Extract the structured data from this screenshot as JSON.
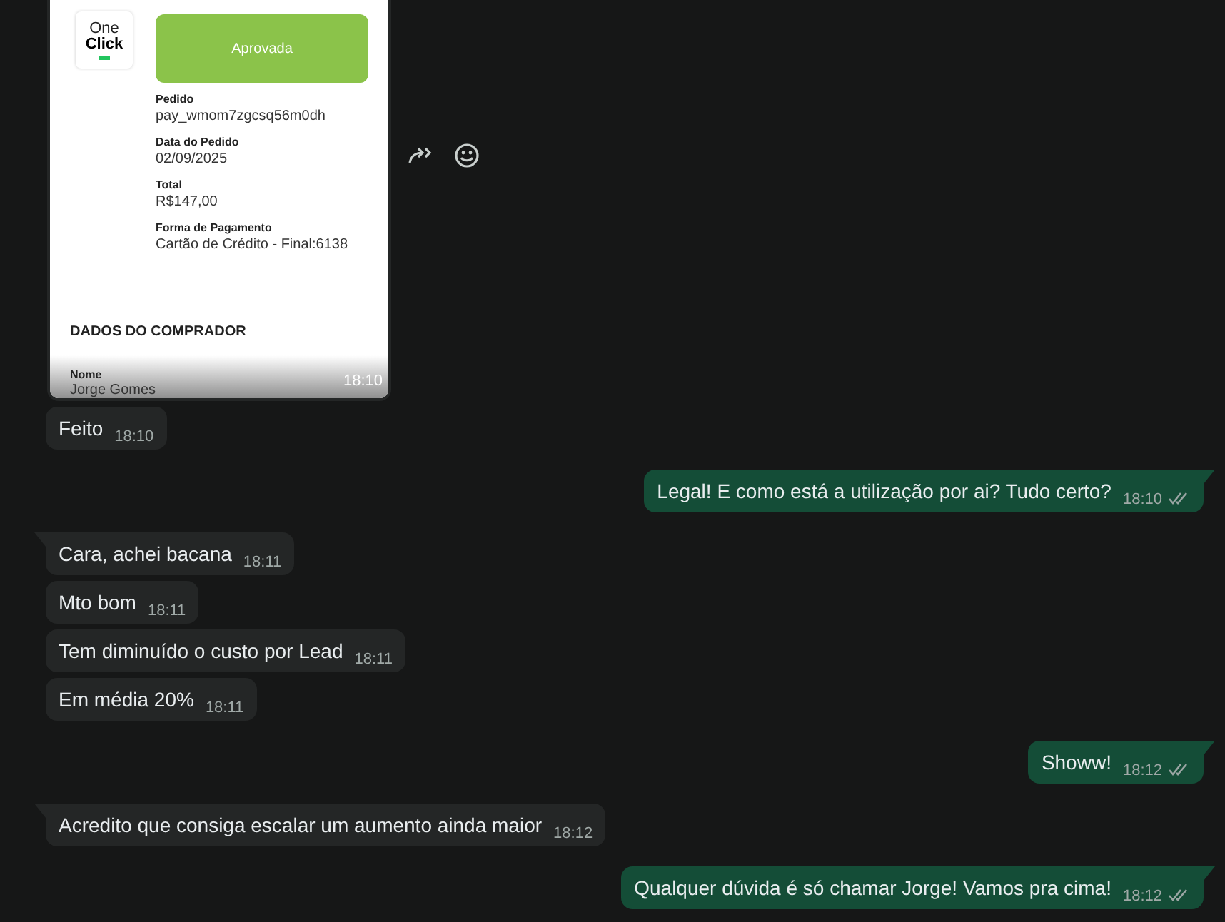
{
  "image_message": {
    "logo": {
      "line1": "One",
      "line2": "Click"
    },
    "status_button": "Aprovada",
    "fields": [
      {
        "label": "Pedido",
        "value": "pay_wmom7zgcsq56m0dh"
      },
      {
        "label": "Data do Pedido",
        "value": "02/09/2025"
      },
      {
        "label": "Total",
        "value": "R$147,00"
      },
      {
        "label": "Forma de Pagamento",
        "value": "Cartão de Crédito - Final:6138"
      }
    ],
    "section_title": "DADOS DO COMPRADOR",
    "buyer_label": "Nome",
    "buyer_value": "Jorge Gomes",
    "time": "18:10"
  },
  "messages": [
    {
      "kind": "incoming",
      "tail": false,
      "text": "Feito",
      "time": "18:10"
    },
    {
      "kind": "outgoing",
      "tail": true,
      "text": "Legal! E como está a utilização por ai? Tudo certo?",
      "time": "18:10"
    },
    {
      "kind": "incoming",
      "tail": true,
      "text": "Cara, achei bacana",
      "time": "18:11"
    },
    {
      "kind": "incoming",
      "tail": false,
      "text": "Mto bom",
      "time": "18:11"
    },
    {
      "kind": "incoming",
      "tail": false,
      "text": "Tem diminuído o custo por Lead",
      "time": "18:11"
    },
    {
      "kind": "incoming",
      "tail": false,
      "text": "Em média 20%",
      "time": "18:11"
    },
    {
      "kind": "outgoing",
      "tail": true,
      "text": "Showw!",
      "time": "18:12"
    },
    {
      "kind": "incoming",
      "tail": true,
      "text": "Acredito que consiga escalar um aumento ainda maior",
      "time": "18:12"
    },
    {
      "kind": "outgoing",
      "tail": true,
      "text": "Qualquer dúvida é só chamar Jorge! Vamos pra cima!",
      "time": "18:12"
    }
  ]
}
